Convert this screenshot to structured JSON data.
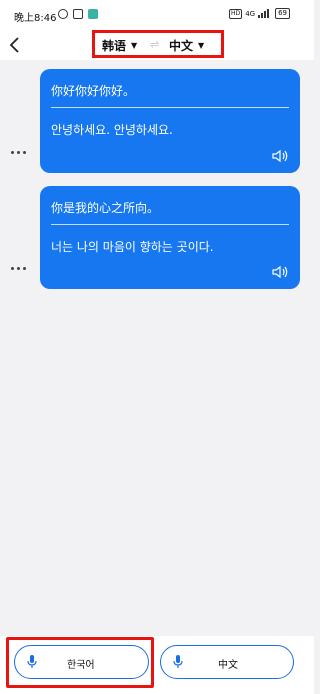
{
  "status_bar": {
    "time": "晚上8:46",
    "network": "4G",
    "battery": "69"
  },
  "header": {
    "source_language": "韩语",
    "target_language": "中文"
  },
  "messages": [
    {
      "source_text": "你好你好你好。",
      "translated_text": "안녕하세요. 안녕하세요."
    },
    {
      "source_text": "你是我的心之所向。",
      "translated_text": "너는 나의 마음이 향하는 곳이다."
    }
  ],
  "bottom_bar": {
    "left_button_label": "한국어",
    "right_button_label": "中文"
  },
  "colors": {
    "accent": "#1677f0",
    "highlight": "#e8140f"
  }
}
